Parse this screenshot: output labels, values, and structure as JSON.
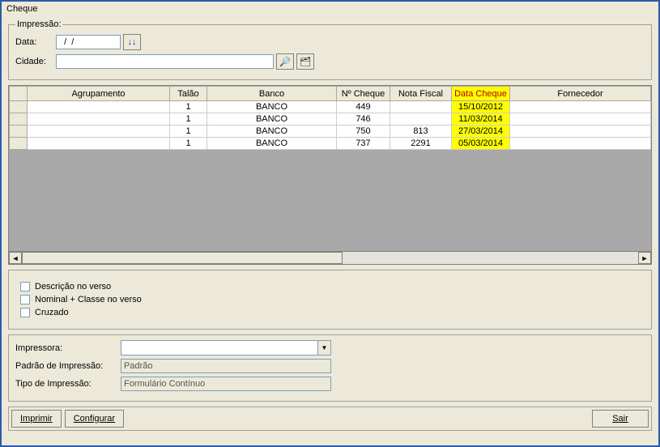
{
  "window": {
    "title": "Cheque"
  },
  "impressao": {
    "legend": "Impressão:",
    "data_label": "Data:",
    "data_value": "  /  /    ",
    "cidade_label": "Cidade:",
    "cidade_value": ""
  },
  "grid": {
    "columns": {
      "agrupamento": "Agrupamento",
      "talao": "Talão",
      "banco": "Banco",
      "num_cheque": "Nº Cheque",
      "nota_fiscal": "Nota Fiscal",
      "data_cheque": "Data Cheque",
      "fornecedor": "Fornecedor"
    },
    "rows": [
      {
        "agrupamento": "",
        "talao": "1",
        "banco": "BANCO",
        "num_cheque": "449",
        "nota_fiscal": "",
        "data_cheque": "15/10/2012",
        "fornecedor": ""
      },
      {
        "agrupamento": "",
        "talao": "1",
        "banco": "BANCO",
        "num_cheque": "746",
        "nota_fiscal": "",
        "data_cheque": "11/03/2014",
        "fornecedor": ""
      },
      {
        "agrupamento": "",
        "talao": "1",
        "banco": "BANCO",
        "num_cheque": "750",
        "nota_fiscal": "813",
        "data_cheque": "27/03/2014",
        "fornecedor": ""
      },
      {
        "agrupamento": "",
        "talao": "1",
        "banco": "BANCO",
        "num_cheque": "737",
        "nota_fiscal": "2291",
        "data_cheque": "05/03/2014",
        "fornecedor": ""
      }
    ]
  },
  "options": {
    "descricao_verso": "Descrição no verso",
    "nominal_classe": "Nominal + Classe no verso",
    "cruzado": "Cruzado"
  },
  "printer": {
    "impressora_label": "Impressora:",
    "impressora_value": "",
    "padrao_label": "Padrão de Impressão:",
    "padrao_value": "Padrão",
    "tipo_label": "Tipo de Impressão:",
    "tipo_value": "Formulário Contínuo"
  },
  "buttons": {
    "imprimir": "Imprimir",
    "configurar": "Configurar",
    "sair": "Sair"
  }
}
